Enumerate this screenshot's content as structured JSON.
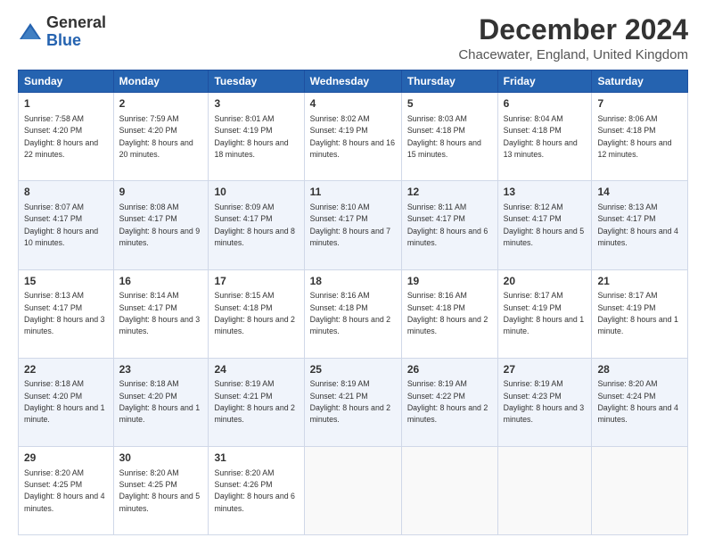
{
  "header": {
    "logo_general": "General",
    "logo_blue": "Blue",
    "month_title": "December 2024",
    "location": "Chacewater, England, United Kingdom"
  },
  "days_of_week": [
    "Sunday",
    "Monday",
    "Tuesday",
    "Wednesday",
    "Thursday",
    "Friday",
    "Saturday"
  ],
  "weeks": [
    [
      {
        "day": "1",
        "sunrise": "7:58 AM",
        "sunset": "4:20 PM",
        "daylight": "8 hours and 22 minutes."
      },
      {
        "day": "2",
        "sunrise": "7:59 AM",
        "sunset": "4:20 PM",
        "daylight": "8 hours and 20 minutes."
      },
      {
        "day": "3",
        "sunrise": "8:01 AM",
        "sunset": "4:19 PM",
        "daylight": "8 hours and 18 minutes."
      },
      {
        "day": "4",
        "sunrise": "8:02 AM",
        "sunset": "4:19 PM",
        "daylight": "8 hours and 16 minutes."
      },
      {
        "day": "5",
        "sunrise": "8:03 AM",
        "sunset": "4:18 PM",
        "daylight": "8 hours and 15 minutes."
      },
      {
        "day": "6",
        "sunrise": "8:04 AM",
        "sunset": "4:18 PM",
        "daylight": "8 hours and 13 minutes."
      },
      {
        "day": "7",
        "sunrise": "8:06 AM",
        "sunset": "4:18 PM",
        "daylight": "8 hours and 12 minutes."
      }
    ],
    [
      {
        "day": "8",
        "sunrise": "8:07 AM",
        "sunset": "4:17 PM",
        "daylight": "8 hours and 10 minutes."
      },
      {
        "day": "9",
        "sunrise": "8:08 AM",
        "sunset": "4:17 PM",
        "daylight": "8 hours and 9 minutes."
      },
      {
        "day": "10",
        "sunrise": "8:09 AM",
        "sunset": "4:17 PM",
        "daylight": "8 hours and 8 minutes."
      },
      {
        "day": "11",
        "sunrise": "8:10 AM",
        "sunset": "4:17 PM",
        "daylight": "8 hours and 7 minutes."
      },
      {
        "day": "12",
        "sunrise": "8:11 AM",
        "sunset": "4:17 PM",
        "daylight": "8 hours and 6 minutes."
      },
      {
        "day": "13",
        "sunrise": "8:12 AM",
        "sunset": "4:17 PM",
        "daylight": "8 hours and 5 minutes."
      },
      {
        "day": "14",
        "sunrise": "8:13 AM",
        "sunset": "4:17 PM",
        "daylight": "8 hours and 4 minutes."
      }
    ],
    [
      {
        "day": "15",
        "sunrise": "8:13 AM",
        "sunset": "4:17 PM",
        "daylight": "8 hours and 3 minutes."
      },
      {
        "day": "16",
        "sunrise": "8:14 AM",
        "sunset": "4:17 PM",
        "daylight": "8 hours and 3 minutes."
      },
      {
        "day": "17",
        "sunrise": "8:15 AM",
        "sunset": "4:18 PM",
        "daylight": "8 hours and 2 minutes."
      },
      {
        "day": "18",
        "sunrise": "8:16 AM",
        "sunset": "4:18 PM",
        "daylight": "8 hours and 2 minutes."
      },
      {
        "day": "19",
        "sunrise": "8:16 AM",
        "sunset": "4:18 PM",
        "daylight": "8 hours and 2 minutes."
      },
      {
        "day": "20",
        "sunrise": "8:17 AM",
        "sunset": "4:19 PM",
        "daylight": "8 hours and 1 minute."
      },
      {
        "day": "21",
        "sunrise": "8:17 AM",
        "sunset": "4:19 PM",
        "daylight": "8 hours and 1 minute."
      }
    ],
    [
      {
        "day": "22",
        "sunrise": "8:18 AM",
        "sunset": "4:20 PM",
        "daylight": "8 hours and 1 minute."
      },
      {
        "day": "23",
        "sunrise": "8:18 AM",
        "sunset": "4:20 PM",
        "daylight": "8 hours and 1 minute."
      },
      {
        "day": "24",
        "sunrise": "8:19 AM",
        "sunset": "4:21 PM",
        "daylight": "8 hours and 2 minutes."
      },
      {
        "day": "25",
        "sunrise": "8:19 AM",
        "sunset": "4:21 PM",
        "daylight": "8 hours and 2 minutes."
      },
      {
        "day": "26",
        "sunrise": "8:19 AM",
        "sunset": "4:22 PM",
        "daylight": "8 hours and 2 minutes."
      },
      {
        "day": "27",
        "sunrise": "8:19 AM",
        "sunset": "4:23 PM",
        "daylight": "8 hours and 3 minutes."
      },
      {
        "day": "28",
        "sunrise": "8:20 AM",
        "sunset": "4:24 PM",
        "daylight": "8 hours and 4 minutes."
      }
    ],
    [
      {
        "day": "29",
        "sunrise": "8:20 AM",
        "sunset": "4:25 PM",
        "daylight": "8 hours and 4 minutes."
      },
      {
        "day": "30",
        "sunrise": "8:20 AM",
        "sunset": "4:25 PM",
        "daylight": "8 hours and 5 minutes."
      },
      {
        "day": "31",
        "sunrise": "8:20 AM",
        "sunset": "4:26 PM",
        "daylight": "8 hours and 6 minutes."
      },
      null,
      null,
      null,
      null
    ]
  ]
}
